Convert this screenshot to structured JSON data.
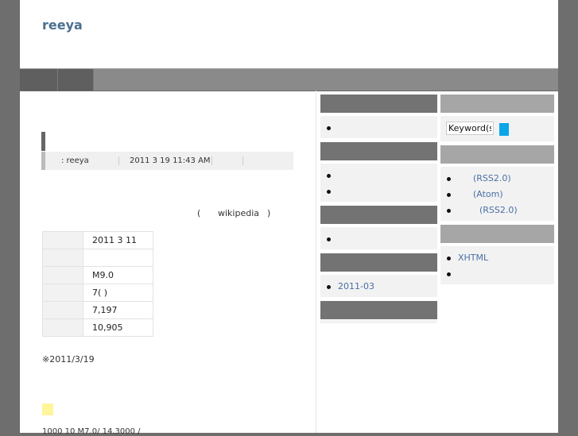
{
  "site": {
    "title": "reeya"
  },
  "nav": {
    "tabs": [
      "",
      ""
    ]
  },
  "post": {
    "meta": {
      "author": ": reeya",
      "date": "2011 3 19  11:43 AM"
    },
    "wiki_open": "(",
    "wiki_link": "wikipedia",
    "wiki_close": ")",
    "facts": [
      {
        "key": "",
        "value": "2011 3 11"
      },
      {
        "key": "",
        "value": ""
      },
      {
        "key": "",
        "value": "M9.0"
      },
      {
        "key": "",
        "value": "7(      )"
      },
      {
        "key": "",
        "value": "7,197"
      },
      {
        "key": "",
        "value": "10,905"
      }
    ],
    "note": "※2011/3/19",
    "cut_text": "1000   10                 M7.0/         14.3000 /"
  },
  "sidebar_left": {
    "archive_link": "2011-03"
  },
  "sidebar_right": {
    "search": {
      "placeholder": "Keyword(s)"
    },
    "feeds": {
      "items": [
        "(RSS2.0)",
        "(Atom)",
        "(RSS2.0)"
      ]
    },
    "misc": {
      "items": [
        "XHTML",
        ""
      ]
    }
  },
  "colors": {
    "background": "#6e6e6e",
    "title": "#4a7090",
    "link": "#4a6fa5",
    "search_button": "#0aa6e8"
  }
}
